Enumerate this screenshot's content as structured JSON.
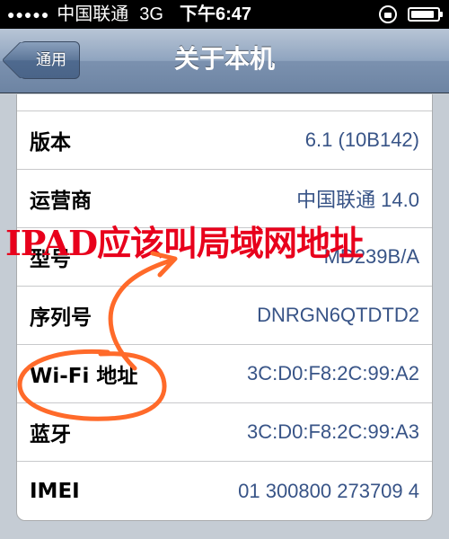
{
  "status_bar": {
    "signal": "●●●●●",
    "carrier": "中国联通",
    "network": "3G",
    "time": "下午6:47",
    "battery_level": 0.9
  },
  "nav": {
    "back_label": "通用",
    "title": "关于本机"
  },
  "rows": [
    {
      "label": "版本",
      "value": "6.1 (10B142)"
    },
    {
      "label": "运营商",
      "value": "中国联通 14.0"
    },
    {
      "label": "型号",
      "value": "MD239B/A"
    },
    {
      "label": "序列号",
      "value": "DNRGN6QTDTD2"
    },
    {
      "label": "Wi-Fi 地址",
      "value": "3C:D0:F8:2C:99:A2"
    },
    {
      "label": "蓝牙",
      "value": "3C:D0:F8:2C:99:A3"
    },
    {
      "label": "IMEI",
      "value": "01 300800 273709 4"
    }
  ],
  "annotation": {
    "caption": "IPAD应该叫局域网地址",
    "color": "#e8001c"
  },
  "colors": {
    "accent_value": "#385487",
    "nav_bar": "#7b91af"
  }
}
